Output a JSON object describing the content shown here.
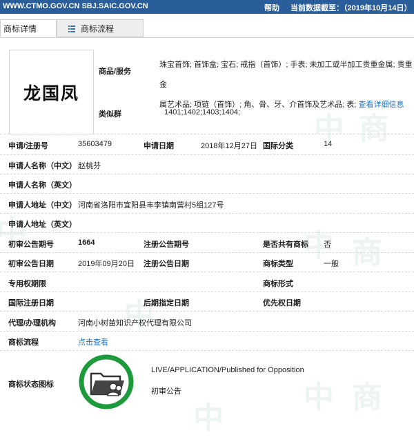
{
  "topbar": {
    "site": "WWW.CTMO.GOV.CN SBJ.SAIC.GOV.CN",
    "help": "帮助",
    "current_date": "当前数据截至：（2019年10月14日）"
  },
  "tabs": [
    {
      "label": "商标详情"
    },
    {
      "label": "商标流程"
    }
  ],
  "trademark": {
    "logo_text": "龙国凤",
    "goods_label": "商品/服务",
    "goods_line1": "珠宝首饰; 首饰盒; 宝石; 戒指（首饰）; 手表; 未加工或半加工贵重金属; 贵重金",
    "goods_line2": "属艺术品; 项链（首饰）; 角、骨、牙、介首饰及艺术品; 表;",
    "goods_more": "查看详细信息",
    "similar_label": "类似群",
    "similar_value": "1401;1402;1403;1404;"
  },
  "fields": {
    "reg_no_label": "申请/注册号",
    "reg_no": "35603479",
    "app_date_label": "申请日期",
    "app_date": "2018年12月27日",
    "intl_class_label": "国际分类",
    "intl_class": "14",
    "applicant_cn_label": "申请人名称（中文）",
    "applicant_cn": "赵桃芬",
    "applicant_en_label": "申请人名称（英文）",
    "address_cn_label": "申请人地址（中文）",
    "address_cn": "河南省洛阳市宜阳县丰李镇南营村5组127号",
    "address_en_label": "申请人地址（英文）",
    "prelim_no_label": "初审公告期号",
    "prelim_no": "1664",
    "reg_pub_no_label": "注册公告期号",
    "shared_label": "是否共有商标",
    "shared": "否",
    "prelim_date_label": "初审公告日期",
    "prelim_date": "2019年09月20日",
    "reg_pub_date_label": "注册公告日期",
    "tm_type_label": "商标类型",
    "tm_type": "一般",
    "exclusive_label": "专用权期限",
    "tm_form_label": "商标形式",
    "intl_reg_date_label": "国际注册日期",
    "later_date_label": "后期指定日期",
    "priority_date_label": "优先权日期",
    "agent_label": "代理/办理机构",
    "agent": "河南小树苗知识产权代理有限公司",
    "process_label": "商标流程",
    "process_link": "点击查看",
    "status_icon_label": "商标状态图标",
    "status_en": "LIVE/APPLICATION/Published for Opposition",
    "status_cn": "初审公告"
  },
  "colors": {
    "topbar": "#2a5e9a",
    "link": "#1c6fc8",
    "status_ring": "#1d9a3a",
    "folder_icon": "#333333"
  },
  "icons": [
    "grid-icon",
    "folder-people-icon"
  ]
}
